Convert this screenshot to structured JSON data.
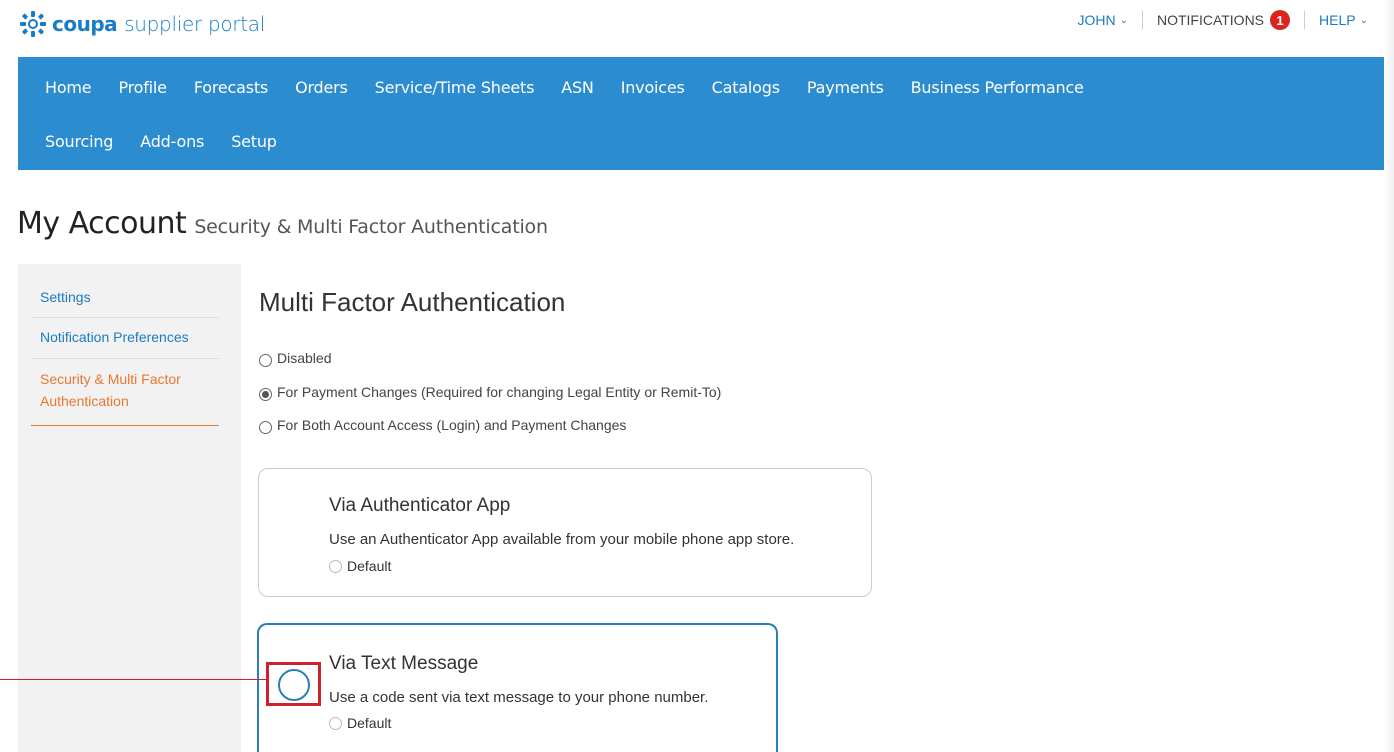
{
  "brand": {
    "name": "coupa",
    "suffix": "supplier portal",
    "colors": {
      "brand_blue": "#1a7cc4",
      "nav_blue": "#2b8ccf",
      "accent_orange": "#e8772e",
      "badge_red": "#d9251d",
      "highlight_red": "#d0202e"
    }
  },
  "usermenu": {
    "user": "JOHN",
    "notifications_label": "NOTIFICATIONS",
    "notifications_count": "1",
    "help": "HELP"
  },
  "nav": {
    "row1": [
      "Home",
      "Profile",
      "Forecasts",
      "Orders",
      "Service/Time Sheets",
      "ASN",
      "Invoices",
      "Catalogs",
      "Payments",
      "Business Performance"
    ],
    "row2": [
      "Sourcing",
      "Add-ons",
      "Setup"
    ]
  },
  "page": {
    "title": "My Account",
    "subtitle": "Security & Multi Factor Authentication"
  },
  "sidebar": {
    "items": [
      {
        "label": "Settings",
        "active": false
      },
      {
        "label": "Notification Preferences",
        "active": false
      },
      {
        "label_line1": "Security & Multi Factor",
        "label_line2": "Authentication",
        "active": true
      }
    ]
  },
  "mfa": {
    "title": "Multi Factor Authentication",
    "options": [
      {
        "label": "Disabled",
        "checked": false
      },
      {
        "label": "For Payment Changes (Required for changing Legal Entity or Remit-To)",
        "checked": true
      },
      {
        "label": "For Both Account Access (Login) and Payment Changes",
        "checked": false
      }
    ],
    "methods": [
      {
        "title": "Via Authenticator App",
        "desc": "Use an Authenticator App available from your mobile phone app store.",
        "default_label": "Default"
      },
      {
        "title": "Via Text Message",
        "desc": "Use a code sent via text message to your phone number.",
        "default_label": "Default"
      }
    ]
  }
}
